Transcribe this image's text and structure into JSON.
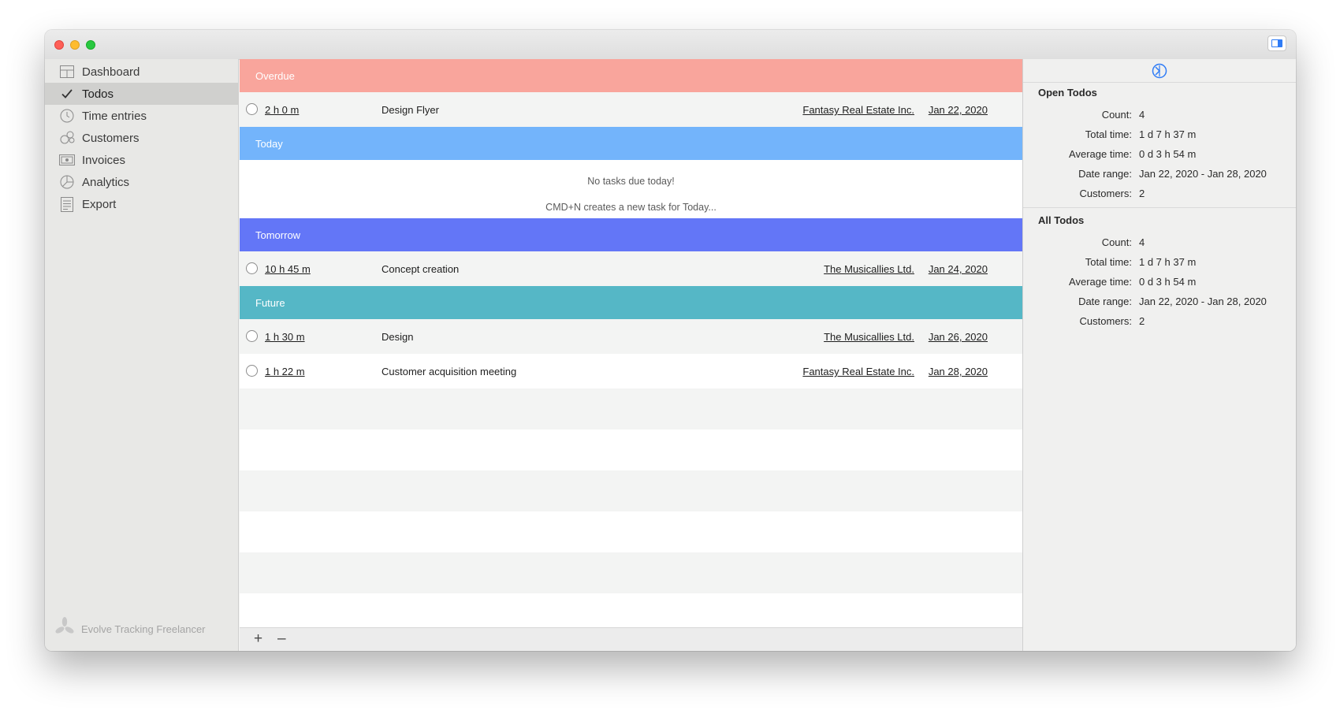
{
  "sidebar": {
    "items": [
      {
        "label": "Dashboard",
        "icon": "dashboard-icon"
      },
      {
        "label": "Todos",
        "icon": "checkmark-icon",
        "selected": true
      },
      {
        "label": "Time entries",
        "icon": "clock-icon"
      },
      {
        "label": "Customers",
        "icon": "customers-icon"
      },
      {
        "label": "Invoices",
        "icon": "invoice-icon"
      },
      {
        "label": "Analytics",
        "icon": "pie-chart-icon"
      },
      {
        "label": "Export",
        "icon": "export-icon"
      }
    ],
    "brand": "Evolve Tracking Freelancer"
  },
  "sections": {
    "overdue": {
      "label": "Overdue",
      "color": "#f9a59c",
      "rows": [
        {
          "duration": "2 h 0 m",
          "title": "Design Flyer",
          "customer": "Fantasy Real Estate Inc.",
          "date": "Jan 22, 2020"
        }
      ]
    },
    "today": {
      "label": "Today",
      "color": "#73b4fb",
      "empty_line1": "No tasks due today!",
      "empty_line2": "CMD+N creates a new task for Today..."
    },
    "tomorrow": {
      "label": "Tomorrow",
      "color": "#6376f7",
      "rows": [
        {
          "duration": "10 h 45 m",
          "title": "Concept creation",
          "customer": "The Musicallies Ltd.",
          "date": "Jan 24, 2020"
        }
      ]
    },
    "future": {
      "label": "Future",
      "color": "#55b7c6",
      "rows": [
        {
          "duration": "1 h 30 m",
          "title": "Design",
          "customer": "The Musicallies Ltd.",
          "date": "Jan 26, 2020"
        },
        {
          "duration": "1 h 22 m",
          "title": "Customer acquisition meeting",
          "customer": "Fantasy Real Estate Inc.",
          "date": "Jan 28, 2020"
        }
      ]
    }
  },
  "bottom_bar": {
    "add": "+",
    "remove": "–"
  },
  "inspector": {
    "open": {
      "title": "Open Todos",
      "rows": [
        {
          "key": "Count:",
          "value": "4"
        },
        {
          "key": "Total time:",
          "value": "1 d 7 h 37 m"
        },
        {
          "key": "Average time:",
          "value": "0 d 3 h 54 m"
        },
        {
          "key": "Date range:",
          "value": "Jan 22, 2020 - Jan 28, 2020"
        },
        {
          "key": "Customers:",
          "value": "2"
        }
      ]
    },
    "all": {
      "title": "All Todos",
      "rows": [
        {
          "key": "Count:",
          "value": "4"
        },
        {
          "key": "Total time:",
          "value": "1 d 7 h 37 m"
        },
        {
          "key": "Average time:",
          "value": "0 d 3 h 54 m"
        },
        {
          "key": "Date range:",
          "value": "Jan 22, 2020 - Jan 28, 2020"
        },
        {
          "key": "Customers:",
          "value": "2"
        }
      ]
    }
  },
  "colors": {
    "accent": "#2f7cf6"
  }
}
